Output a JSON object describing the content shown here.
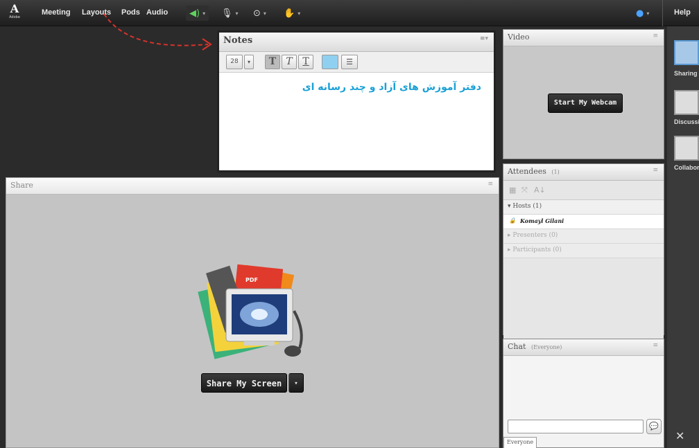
{
  "app": {
    "logo_letter": "A",
    "logo_caption": "Adobe"
  },
  "menu": {
    "items": [
      "Meeting",
      "Layouts",
      "Pods",
      "Audio"
    ],
    "help": "Help"
  },
  "toolbar": {
    "icons": [
      "speaker-icon",
      "microphone-icon",
      "webcam-icon",
      "raise-hand-icon",
      "status-icon"
    ],
    "caret": "▾"
  },
  "notes": {
    "title": "Notes",
    "font_size": "28",
    "bold": "T",
    "italic": "T",
    "underline": "T",
    "content": "دفتر آموزش های آزاد و چند رسانه ای",
    "text_color": "#1aa0d6"
  },
  "video": {
    "title": "Video",
    "start_webcam": "Start My Webcam"
  },
  "attendees": {
    "title": "Attendees",
    "count": "(1)",
    "groups": [
      {
        "label": "Hosts (1)",
        "expanded": true
      },
      {
        "label": "Presenters (0)",
        "expanded": false
      },
      {
        "label": "Participants (0)",
        "expanded": false
      }
    ],
    "host_name": "Komayl Gilani"
  },
  "chat": {
    "title": "Chat",
    "scope": "(Everyone)",
    "tab": "Everyone"
  },
  "share": {
    "title": "Share",
    "button": "Share My Screen",
    "dropdown_caret": "▾"
  },
  "layouts_panel": {
    "items": [
      "Sharing",
      "Discussion",
      "Collabor"
    ]
  },
  "colors": {
    "annotation_arrow": "#d9322b",
    "accent_blue": "#5b9bd5"
  }
}
